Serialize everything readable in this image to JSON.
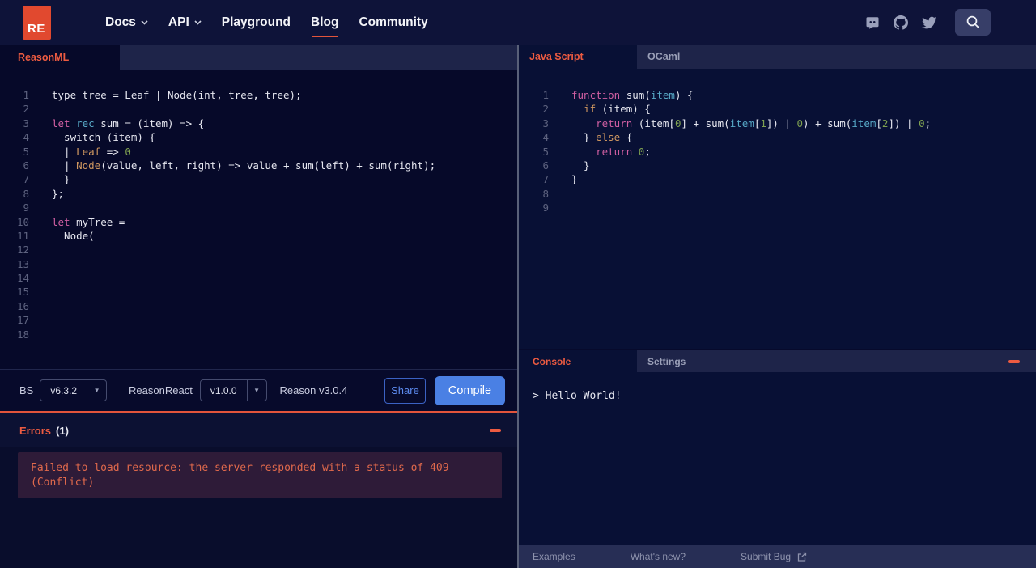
{
  "nav": {
    "logo_text": "RE",
    "items": [
      {
        "label": "Docs",
        "chevron": true,
        "active": false
      },
      {
        "label": "API",
        "chevron": true,
        "active": false
      },
      {
        "label": "Playground",
        "chevron": false,
        "active": false
      },
      {
        "label": "Blog",
        "chevron": false,
        "active": true
      },
      {
        "label": "Community",
        "chevron": false,
        "active": false
      }
    ],
    "social_icons": [
      "discord-icon",
      "github-icon",
      "twitter-icon"
    ],
    "search_icon": "search-icon"
  },
  "left_panel": {
    "tab_label": "ReasonML",
    "editor": {
      "lines": [
        [
          [
            "p",
            "type tree = Leaf | Node(int, tree, tree);"
          ]
        ],
        [],
        [
          [
            "k",
            "let"
          ],
          [
            "p",
            " "
          ],
          [
            "c",
            "rec"
          ],
          [
            "p",
            " sum = (item) => {"
          ]
        ],
        [
          [
            "p",
            "  switch (item) {"
          ]
        ],
        [
          [
            "p",
            "  | "
          ],
          [
            "o",
            "Leaf"
          ],
          [
            "p",
            " => "
          ],
          [
            "g",
            "0"
          ]
        ],
        [
          [
            "p",
            "  | "
          ],
          [
            "o",
            "Node"
          ],
          [
            "p",
            "(value, left, right) => value + sum(left) + sum(right);"
          ]
        ],
        [
          [
            "p",
            "  }"
          ]
        ],
        [
          [
            "p",
            "};"
          ]
        ],
        [],
        [
          [
            "k",
            "let"
          ],
          [
            "p",
            " myTree ="
          ]
        ],
        [
          [
            "p",
            "  Node("
          ]
        ],
        [],
        [],
        [],
        [],
        [],
        [],
        []
      ]
    },
    "toolbar": {
      "bs_label": "BS",
      "bs_version": "v6.3.2",
      "reasonreact_label": "ReasonReact",
      "reasonreact_version": "v1.0.0",
      "reason_version": "Reason v3.0.4",
      "share_label": "Share",
      "compile_label": "Compile"
    },
    "errors": {
      "title": "Errors",
      "count": "(1)",
      "message_lines": [
        "Failed to load resource: the server responded with a status of 409",
        "(Conflict)"
      ]
    }
  },
  "right_panel": {
    "tabs": [
      {
        "label": "Java Script",
        "active": true
      },
      {
        "label": "OCaml",
        "active": false
      }
    ],
    "editor": {
      "lines": [
        [
          [
            "k",
            "function"
          ],
          [
            "p",
            " sum("
          ],
          [
            "c",
            "item"
          ],
          [
            "p",
            ") {"
          ]
        ],
        [
          [
            "p",
            "  "
          ],
          [
            "o",
            "if"
          ],
          [
            "p",
            " (item) {"
          ]
        ],
        [
          [
            "p",
            "    "
          ],
          [
            "k",
            "return"
          ],
          [
            "p",
            " (item["
          ],
          [
            "g",
            "0"
          ],
          [
            "p",
            "] + sum("
          ],
          [
            "c",
            "item"
          ],
          [
            "p",
            "["
          ],
          [
            "g",
            "1"
          ],
          [
            "p",
            "]) | "
          ],
          [
            "g",
            "0"
          ],
          [
            "p",
            ") + sum("
          ],
          [
            "c",
            "item"
          ],
          [
            "p",
            "["
          ],
          [
            "g",
            "2"
          ],
          [
            "p",
            "]) | "
          ],
          [
            "g",
            "0"
          ],
          [
            "p",
            ";"
          ]
        ],
        [
          [
            "p",
            "  } "
          ],
          [
            "o",
            "else"
          ],
          [
            "p",
            " {"
          ]
        ],
        [
          [
            "p",
            "    "
          ],
          [
            "k",
            "return"
          ],
          [
            "p",
            " "
          ],
          [
            "g",
            "0"
          ],
          [
            "p",
            ";"
          ]
        ],
        [
          [
            "p",
            "  }"
          ]
        ],
        [
          [
            "p",
            "}"
          ]
        ],
        [],
        []
      ]
    },
    "console": {
      "tabs": [
        {
          "label": "Console",
          "active": true
        },
        {
          "label": "Settings",
          "active": false
        }
      ],
      "output": "> Hello World!"
    },
    "footer_links": [
      "Examples",
      "What's new?",
      "Submit Bug"
    ]
  },
  "colors": {
    "logo_orange": "#e1492f",
    "accent_orange": "#ed5b41",
    "divider_orange": "#e2543b",
    "compile_blue": "#4a80e4",
    "share_blue": "#5d8bf0",
    "error_text": "#e0694c",
    "error_box_bg": "#2e1b38",
    "token_plain": "#e6e7f0",
    "token_keyword": "#d05fa2",
    "token_cyan": "#57a8c6",
    "token_orange": "#cf9760",
    "token_green": "#7ea050"
  }
}
